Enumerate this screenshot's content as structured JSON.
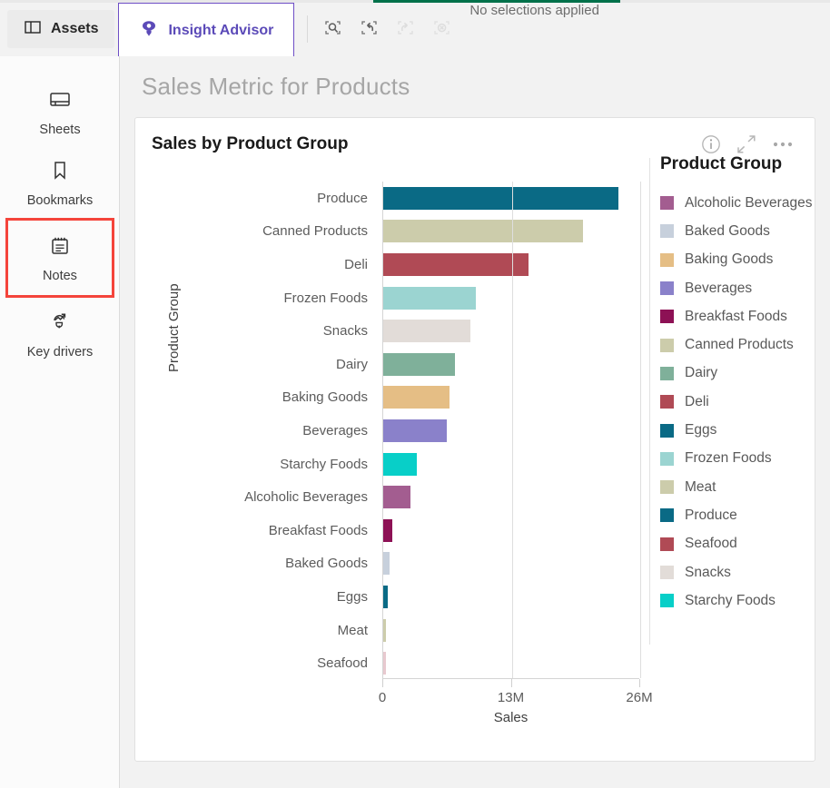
{
  "topbar": {
    "progress_accent": "#00714a",
    "tabs": [
      {
        "label": "Assets",
        "icon": "panel-layout-icon",
        "active": false
      },
      {
        "label": "Insight Advisor",
        "icon": "insight-lightbulb-icon",
        "active": true
      }
    ],
    "tools": [
      {
        "name": "selection-search-icon",
        "enabled": true
      },
      {
        "name": "step-back-icon",
        "enabled": true
      },
      {
        "name": "step-forward-icon",
        "enabled": false
      },
      {
        "name": "clear-selections-icon",
        "enabled": false
      }
    ],
    "selection_status": "No selections applied"
  },
  "sidebar": {
    "items": [
      {
        "label": "Sheets",
        "icon": "sheets-icon",
        "highlighted": false
      },
      {
        "label": "Bookmarks",
        "icon": "bookmark-icon",
        "highlighted": false
      },
      {
        "label": "Notes",
        "icon": "notes-icon",
        "highlighted": true
      },
      {
        "label": "Key drivers",
        "icon": "key-drivers-icon",
        "highlighted": false
      }
    ],
    "highlight_color": "#f4443b"
  },
  "main": {
    "page_title": "Sales Metric for Products",
    "card": {
      "title": "Sales by Product Group",
      "tools": [
        {
          "name": "info-icon"
        },
        {
          "name": "expand-icon"
        },
        {
          "name": "more-options-icon"
        }
      ]
    }
  },
  "chart_data": {
    "type": "bar",
    "orientation": "horizontal",
    "title": "Sales by Product Group",
    "xlabel": "Sales",
    "ylabel": "Product Group",
    "xlim": [
      0,
      26000000
    ],
    "xticks": [
      0,
      13000000,
      26000000
    ],
    "xtick_labels": [
      "0",
      "13M",
      "26M"
    ],
    "grid": true,
    "legend_title": "Product Group",
    "legend_position": "right",
    "categories": [
      "Produce",
      "Canned Products",
      "Deli",
      "Frozen Foods",
      "Snacks",
      "Dairy",
      "Baking Goods",
      "Beverages",
      "Starchy Foods",
      "Alcoholic Beverages",
      "Breakfast Foods",
      "Baked Goods",
      "Eggs",
      "Meat",
      "Seafood"
    ],
    "values": [
      23800000,
      20200000,
      14700000,
      9400000,
      8800000,
      7300000,
      6700000,
      6400000,
      3400000,
      2800000,
      900000,
      620000,
      450000,
      260000,
      240000
    ],
    "colors": [
      "#0a6a85",
      "#ccccab",
      "#b04a55",
      "#9bd4d1",
      "#e2dcd8",
      "#7fb09a",
      "#e5be85",
      "#8a81ca",
      "#08cfc8",
      "#a35d90",
      "#8d1155",
      "#c7d0dc",
      "#0a6a85",
      "#ccccab",
      "#e8c9cf"
    ],
    "legend_entries": [
      {
        "label": "Alcoholic Beverages",
        "color": "#a35d90"
      },
      {
        "label": "Baked Goods",
        "color": "#c7d0dc"
      },
      {
        "label": "Baking Goods",
        "color": "#e5be85"
      },
      {
        "label": "Beverages",
        "color": "#8a81ca"
      },
      {
        "label": "Breakfast Foods",
        "color": "#8d1155"
      },
      {
        "label": "Canned Products",
        "color": "#ccccab"
      },
      {
        "label": "Dairy",
        "color": "#7fb09a"
      },
      {
        "label": "Deli",
        "color": "#b04a55"
      },
      {
        "label": "Eggs",
        "color": "#0a6a85"
      },
      {
        "label": "Frozen Foods",
        "color": "#9bd4d1"
      },
      {
        "label": "Meat",
        "color": "#ccccab"
      },
      {
        "label": "Produce",
        "color": "#0a6a85"
      },
      {
        "label": "Seafood",
        "color": "#b04a55"
      },
      {
        "label": "Snacks",
        "color": "#e2dcd8"
      },
      {
        "label": "Starchy Foods",
        "color": "#08cfc8"
      }
    ]
  }
}
